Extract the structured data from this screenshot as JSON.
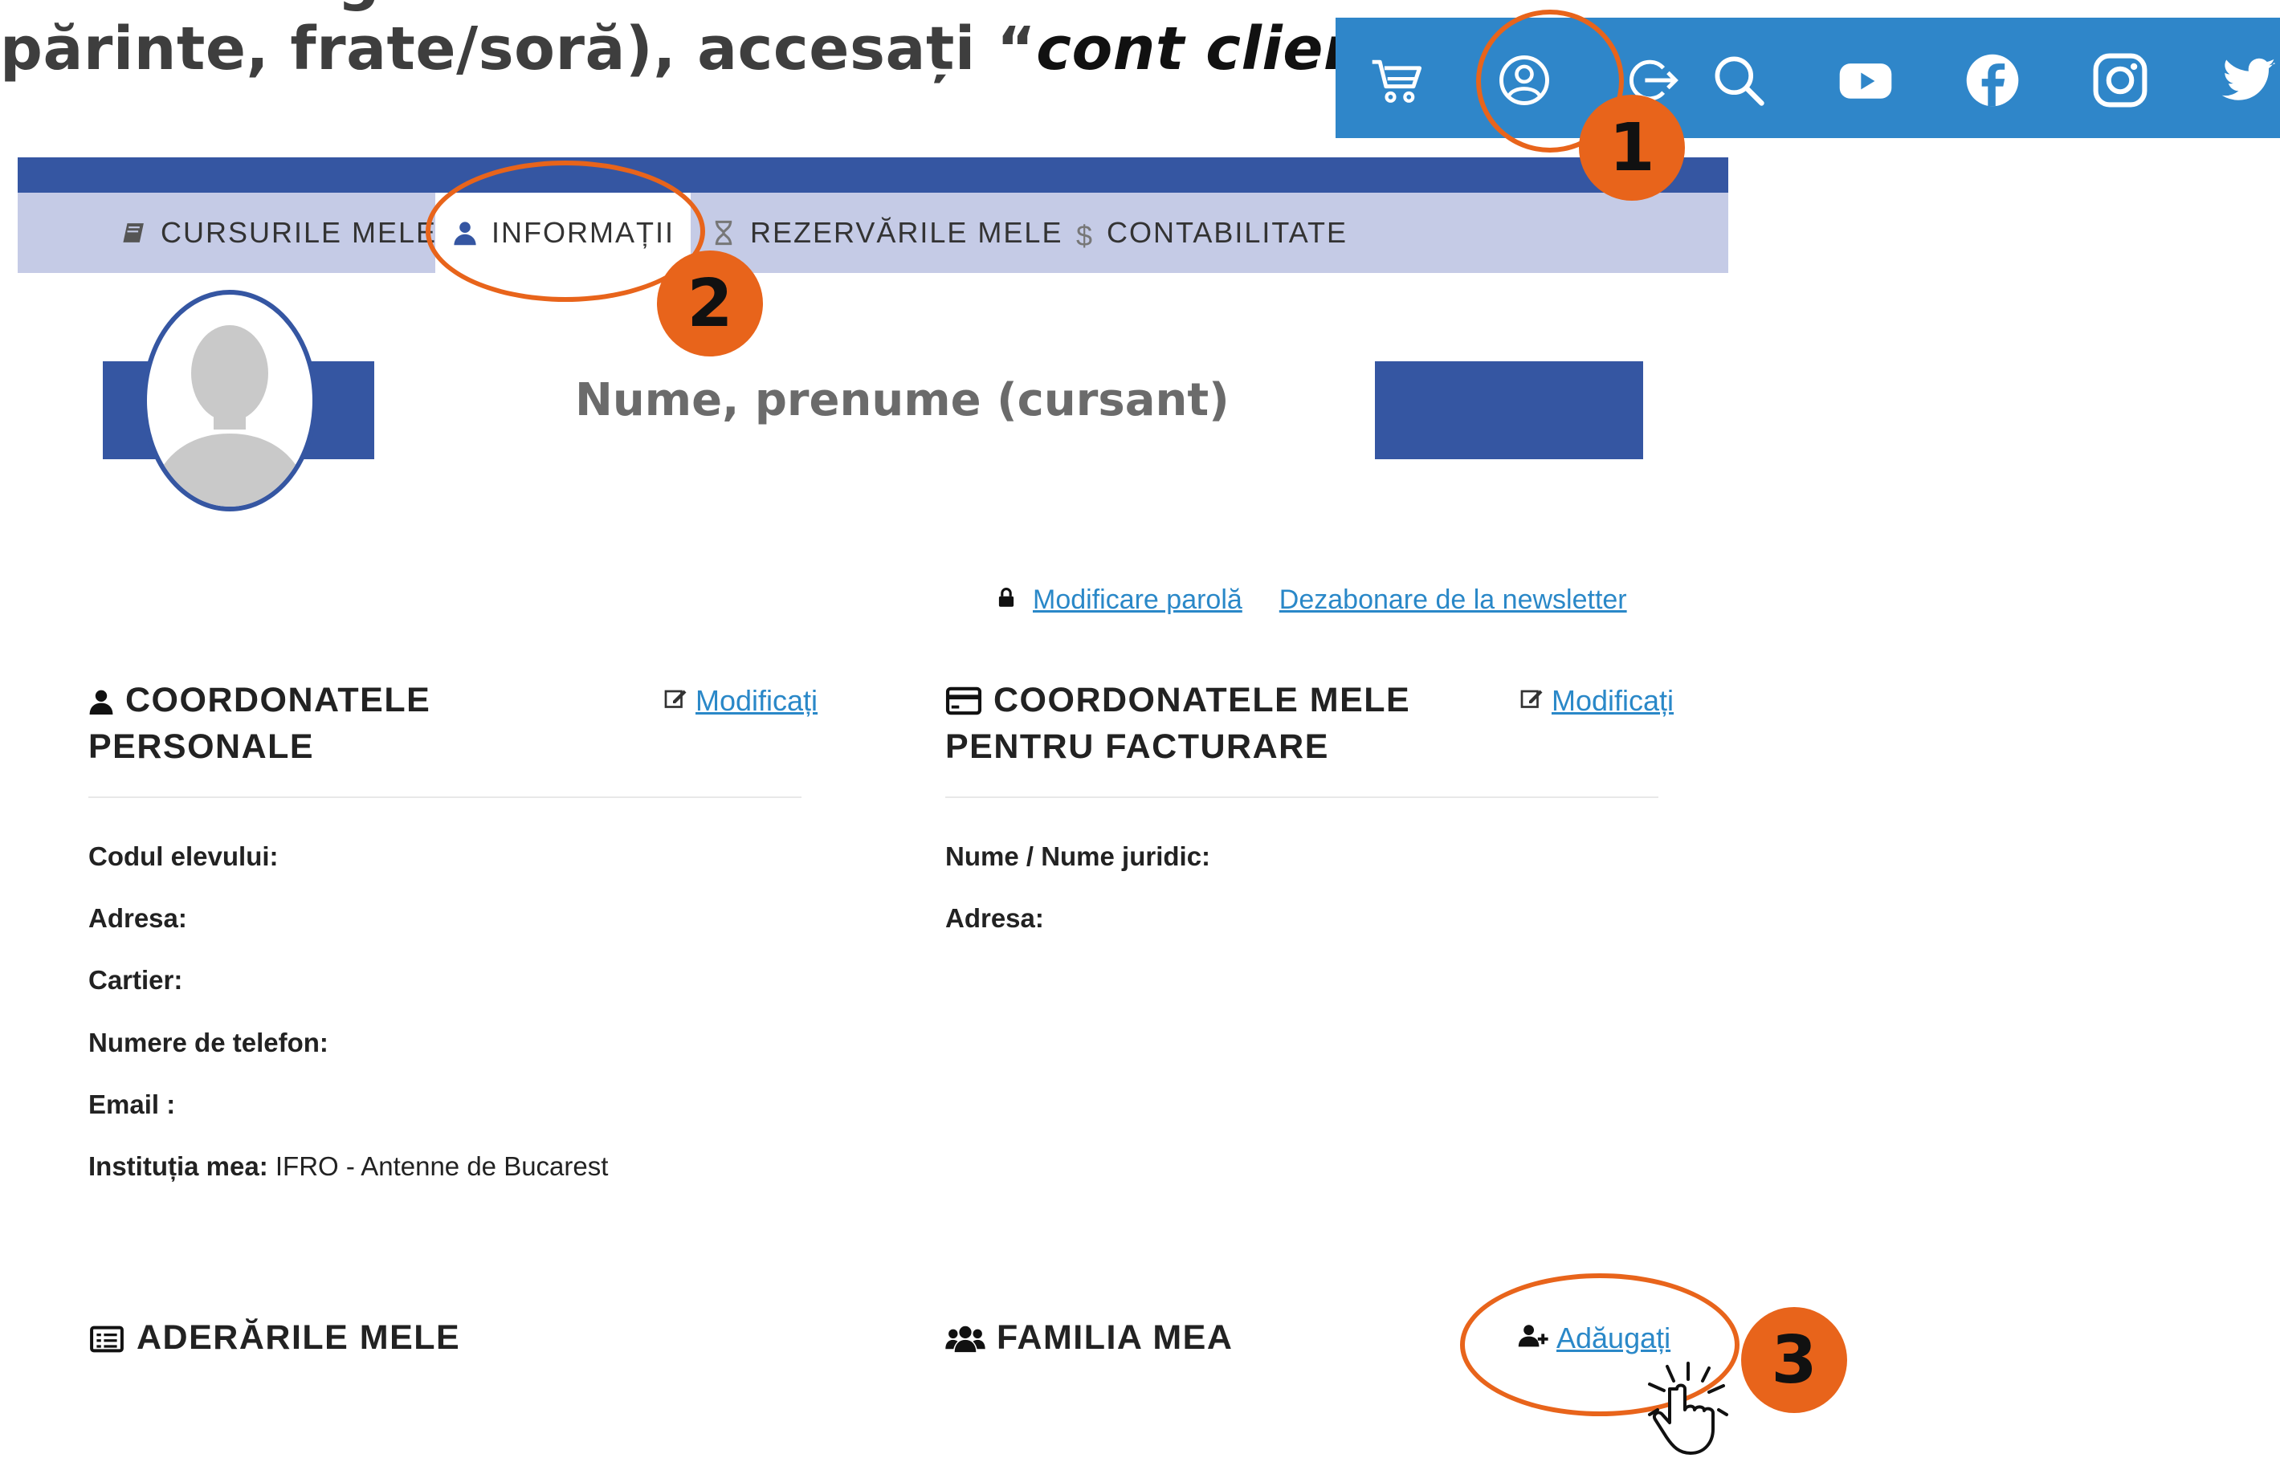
{
  "instruction": {
    "text_normal": "părinte, frate/soră), accesați “",
    "text_italic": "cont client",
    "text_end": "”",
    "cut_text": "g"
  },
  "iconbar": {
    "icons": [
      "cart-icon",
      "user-account-icon",
      "logout-icon",
      "search-icon",
      "youtube-icon",
      "facebook-icon",
      "instagram-icon",
      "twitter-icon"
    ],
    "color": "#2f86c9"
  },
  "tabs": [
    {
      "label": "CURSURILE MELE",
      "icon": "book-icon"
    },
    {
      "label": "INFORMAȚII",
      "icon": "user-icon"
    },
    {
      "label": "REZERVĂRILE MELE",
      "icon": "hourglass-icon"
    },
    {
      "label": "CONTABILITATE",
      "icon": "dollar-icon"
    }
  ],
  "profile": {
    "name_placeholder": "Nume, prenume (cursant)"
  },
  "account_links": {
    "change_password": "Modificare parolă",
    "unsubscribe": "Dezabonare de la newsletter"
  },
  "personal": {
    "title_line1": "COORDONATELE",
    "title_line2": "PERSONALE",
    "edit_label": "Modificați",
    "fields": [
      {
        "label": "Codul elevului:",
        "value": ""
      },
      {
        "label": "Adresa:",
        "value": ""
      },
      {
        "label": "Cartier:",
        "value": ""
      },
      {
        "label": "Numere de telefon:",
        "value": ""
      },
      {
        "label": "Email :",
        "value": ""
      },
      {
        "label": "Instituția mea:",
        "value": " IFRO - Antenne de Bucarest"
      }
    ]
  },
  "billing": {
    "title_line1": "COORDONATELE MELE",
    "title_line2": "PENTRU FACTURARE",
    "edit_label": "Modificați",
    "fields": [
      {
        "label": "Nume / Nume juridic:",
        "value": ""
      },
      {
        "label": "Adresa:",
        "value": ""
      }
    ]
  },
  "memberships": {
    "title": "ADERĂRILE MELE"
  },
  "family": {
    "title": "FAMILIA MEA",
    "add_label": "Adăugați"
  },
  "annotations": {
    "steps": [
      "1",
      "2",
      "3"
    ],
    "accent": "#e8641b"
  },
  "colors": {
    "brand_blue": "#3556a2",
    "tab_bg": "#c5cbe6",
    "link": "#2a88c8"
  }
}
